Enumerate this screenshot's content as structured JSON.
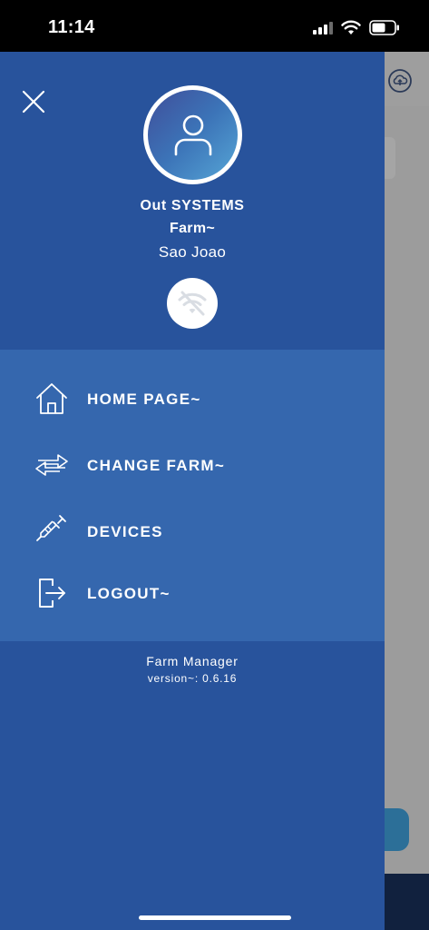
{
  "status_bar": {
    "time": "11:14"
  },
  "drawer": {
    "profile": {
      "company": "Out SYSTEMS",
      "farm": "Farm~",
      "location": "Sao Joao"
    },
    "menu": [
      {
        "label": "HOME PAGE~",
        "icon": "home-icon"
      },
      {
        "label": "CHANGE FARM~",
        "icon": "swap-arrows-icon"
      },
      {
        "label": "DEVICES",
        "icon": "syringe-icon"
      },
      {
        "label": "LOGOUT~",
        "icon": "logout-icon"
      }
    ],
    "footer": {
      "app_name": "Farm Manager",
      "version": "version~: 0.6.16"
    }
  },
  "colors": {
    "drawer_background": "#28539c",
    "menu_background": "#3567ae",
    "accent": "#2c6f98"
  }
}
